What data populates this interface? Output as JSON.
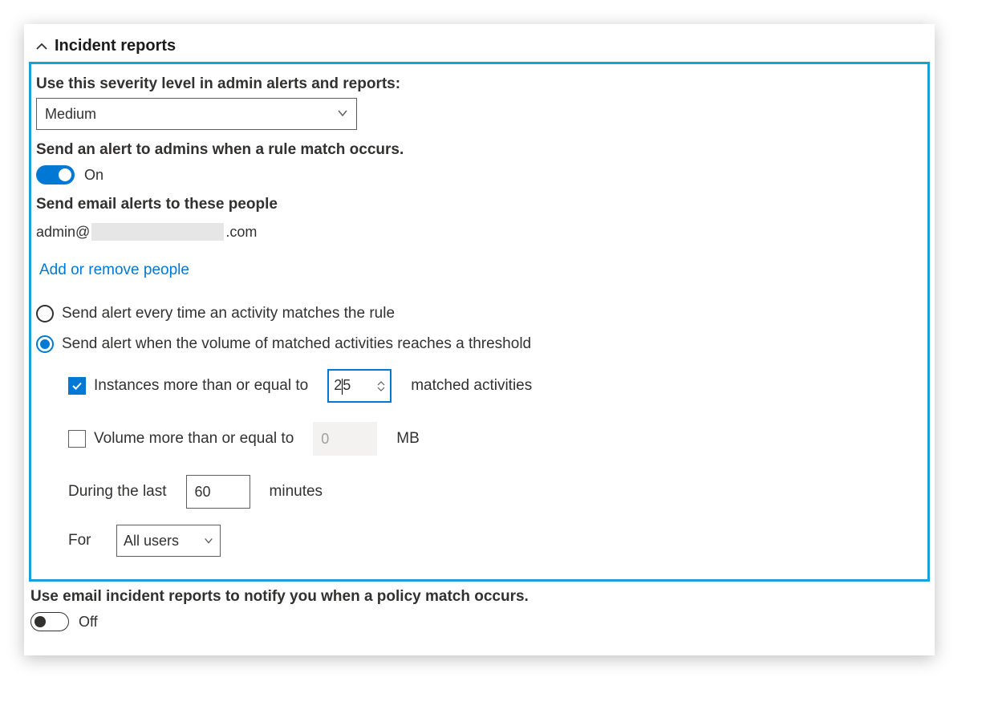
{
  "header": {
    "title": "Incident reports"
  },
  "severity": {
    "label": "Use this severity level in admin alerts and reports:",
    "value": "Medium"
  },
  "alert_admins": {
    "label": "Send an alert to admins when a rule match occurs.",
    "toggle_state": "On"
  },
  "email_alerts": {
    "label": "Send email alerts to these people",
    "email_prefix": "admin@",
    "email_suffix": ".com",
    "link": "Add or remove people"
  },
  "frequency": {
    "option_every": "Send alert every time an activity matches the rule",
    "option_threshold": "Send alert when the volume of matched activities reaches a threshold",
    "selected": "threshold"
  },
  "threshold": {
    "instances": {
      "label": "Instances more than or equal to",
      "checked": true,
      "value": "25",
      "suffix": "matched activities"
    },
    "volume": {
      "label": "Volume more than or equal to",
      "checked": false,
      "value": "0",
      "suffix": "MB"
    },
    "during": {
      "prefix": "During the last",
      "value": "60",
      "suffix": "minutes"
    },
    "for": {
      "label": "For",
      "value": "All users"
    }
  },
  "incident_notify": {
    "label": "Use email incident reports to notify you when a policy match occurs.",
    "toggle_state": "Off"
  }
}
